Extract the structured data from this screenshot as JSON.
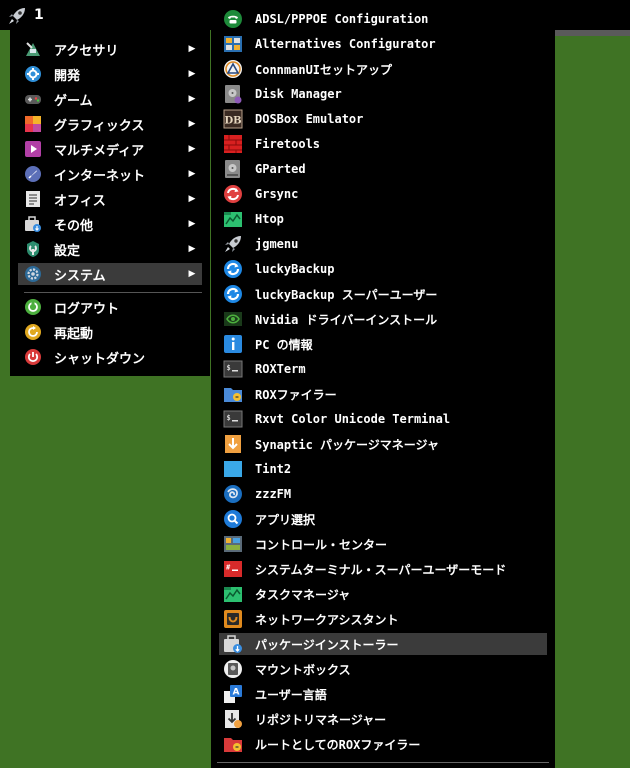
{
  "taskbar": {
    "workspace": "1"
  },
  "main_menu": {
    "items": [
      {
        "label": "アクセサリ",
        "icon": "accessories-icon",
        "has_submenu": true
      },
      {
        "label": "開発",
        "icon": "development-icon",
        "has_submenu": true
      },
      {
        "label": "ゲーム",
        "icon": "gamepad-icon",
        "has_submenu": true
      },
      {
        "label": "グラフィックス",
        "icon": "graphics-icon",
        "has_submenu": true
      },
      {
        "label": "マルチメディア",
        "icon": "multimedia-icon",
        "has_submenu": true
      },
      {
        "label": "インターネット",
        "icon": "internet-icon",
        "has_submenu": true
      },
      {
        "label": "オフィス",
        "icon": "office-icon",
        "has_submenu": true
      },
      {
        "label": "その他",
        "icon": "other-icon",
        "has_submenu": true
      },
      {
        "label": "設定",
        "icon": "settings-icon",
        "has_submenu": true
      },
      {
        "label": "システム",
        "icon": "system-icon",
        "has_submenu": true,
        "selected": true
      }
    ],
    "session_items": [
      {
        "label": "ログアウト",
        "icon": "logout-icon"
      },
      {
        "label": "再起動",
        "icon": "reboot-icon"
      },
      {
        "label": "シャットダウン",
        "icon": "shutdown-icon"
      }
    ],
    "submenu_arrow": "▶"
  },
  "system_submenu": {
    "items": [
      {
        "label": "ADSL/PPPOE Configuration",
        "icon": "phone-icon"
      },
      {
        "label": "Alternatives Configurator",
        "icon": "alternatives-icon"
      },
      {
        "label": "ConnmanUIセットアップ",
        "icon": "connman-icon"
      },
      {
        "label": "Disk Manager",
        "icon": "disk-manager-icon"
      },
      {
        "label": "DOSBox Emulator",
        "icon": "dosbox-icon"
      },
      {
        "label": "Firetools",
        "icon": "firetools-icon"
      },
      {
        "label": "GParted",
        "icon": "gparted-icon"
      },
      {
        "label": "Grsync",
        "icon": "grsync-icon"
      },
      {
        "label": "Htop",
        "icon": "htop-icon"
      },
      {
        "label": "jgmenu",
        "icon": "rocket-icon"
      },
      {
        "label": "luckyBackup",
        "icon": "luckybackup-icon"
      },
      {
        "label": "luckyBackup スーパーユーザー",
        "icon": "luckybackup-super-icon"
      },
      {
        "label": "Nvidia ドライバーインストール",
        "icon": "nvidia-icon"
      },
      {
        "label": "PC の情報",
        "icon": "info-icon"
      },
      {
        "label": "ROXTerm",
        "icon": "terminal-icon"
      },
      {
        "label": "ROXファイラー",
        "icon": "rox-filer-icon"
      },
      {
        "label": "Rxvt Color Unicode Terminal",
        "icon": "rxvt-icon"
      },
      {
        "label": "Synaptic パッケージマネージャ",
        "icon": "synaptic-icon"
      },
      {
        "label": "Tint2",
        "icon": "tint2-icon"
      },
      {
        "label": "zzzFM",
        "icon": "zzzfm-icon"
      },
      {
        "label": "アプリ選択",
        "icon": "app-select-icon"
      },
      {
        "label": "コントロール・センター",
        "icon": "control-center-icon"
      },
      {
        "label": "システムターミナル・スーパーユーザーモード",
        "icon": "root-terminal-icon"
      },
      {
        "label": "タスクマネージャ",
        "icon": "task-manager-icon"
      },
      {
        "label": "ネットワークアシスタント",
        "icon": "network-assistant-icon"
      },
      {
        "label": "パッケージインストーラー",
        "icon": "package-installer-icon",
        "selected": true
      },
      {
        "label": "マウントボックス",
        "icon": "mountbox-icon"
      },
      {
        "label": "ユーザー言語",
        "icon": "user-language-icon"
      },
      {
        "label": "リポジトリマネージャー",
        "icon": "repo-manager-icon"
      },
      {
        "label": "ルートとしてのROXファイラー",
        "icon": "rox-root-icon"
      }
    ]
  }
}
